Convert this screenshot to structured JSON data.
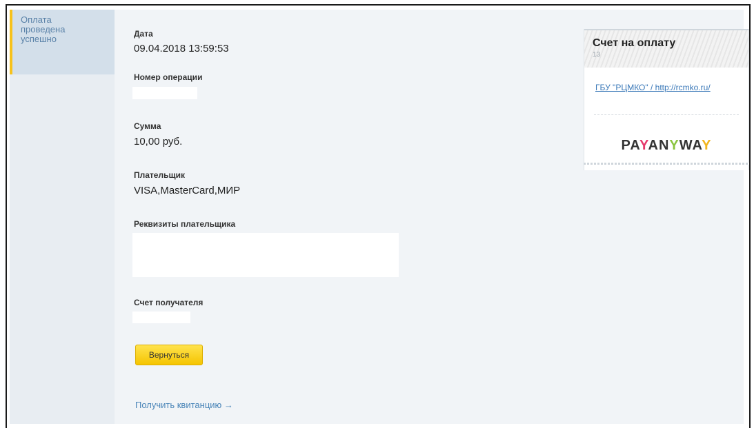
{
  "sidebar": {
    "step_label": "Оплата\nпроведена\nуспешно"
  },
  "fields": {
    "date_label": "Дата",
    "date_value": "09.04.2018 13:59:53",
    "operation_label": "Номер операции",
    "amount_label": "Сумма",
    "amount_value": "10,00  руб.",
    "payer_label": "Плательщик",
    "payer_value": "VISA,MasterCard,МИР",
    "payer_details_label": "Реквизиты плательщика",
    "recipient_account_label": "Счет получателя"
  },
  "actions": {
    "back_label": "Вернуться",
    "receipt_link": "Получить квитанцию →"
  },
  "invoice": {
    "title": "Счет на оплату",
    "number": "13",
    "merchant_link": "ГБУ \"РЦМКО\" / http://rcmko.ru/",
    "logo_pa": "PA",
    "logo_y1": "Y",
    "logo_an": "AN",
    "logo_y2": "Y",
    "logo_wa": "WA",
    "logo_y3": "Y"
  },
  "colors": {
    "accent_yellow": "#f7c21b",
    "link_blue": "#4a85b8",
    "sidebar_bg": "#e8edf2",
    "main_bg": "#f1f4f7"
  }
}
